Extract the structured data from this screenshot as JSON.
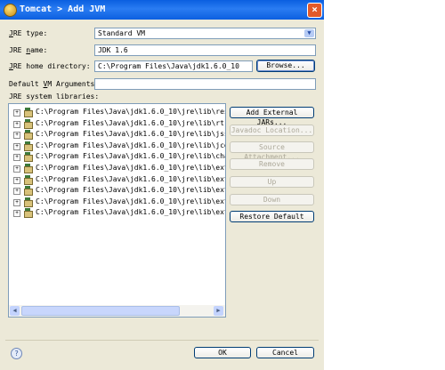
{
  "window": {
    "title": "Tomcat > Add JVM",
    "close_label": "×"
  },
  "form": {
    "jre_type": {
      "label_prefix": "",
      "label_mnemonic": "J",
      "label_rest": "RE type:",
      "value": "Standard VM"
    },
    "jre_name": {
      "label_prefix": "JRE ",
      "label_mnemonic": "n",
      "label_rest": "ame:",
      "value": "JDK 1.6"
    },
    "jre_home": {
      "label_prefix": "",
      "label_mnemonic": "J",
      "label_rest": "RE home directory:",
      "value": "C:\\Program Files\\Java\\jdk1.6.0_10",
      "browse": "Browse..."
    },
    "vm_args": {
      "label_prefix": "Default ",
      "label_mnemonic": "V",
      "label_rest": "M Arguments:",
      "value": ""
    },
    "libraries_label": "JRE system libraries:"
  },
  "libraries": [
    "C:\\Program Files\\Java\\jdk1.6.0_10\\jre\\lib\\resour",
    "C:\\Program Files\\Java\\jdk1.6.0_10\\jre\\lib\\rt.jar",
    "C:\\Program Files\\Java\\jdk1.6.0_10\\jre\\lib\\jsse.j",
    "C:\\Program Files\\Java\\jdk1.6.0_10\\jre\\lib\\jce.ja",
    "C:\\Program Files\\Java\\jdk1.6.0_10\\jre\\lib\\charse",
    "C:\\Program Files\\Java\\jdk1.6.0_10\\jre\\lib\\ext\\dn",
    "C:\\Program Files\\Java\\jdk1.6.0_10\\jre\\lib\\ext\\lo",
    "C:\\Program Files\\Java\\jdk1.6.0_10\\jre\\lib\\ext\\su",
    "C:\\Program Files\\Java\\jdk1.6.0_10\\jre\\lib\\ext\\su",
    "C:\\Program Files\\Java\\jdk1.6.0_10\\jre\\lib\\ext\\su"
  ],
  "side_buttons": {
    "add_external_jars": "Add External JARs...",
    "javadoc_location": "Javadoc Location...",
    "source_attachment": "Source Attachment...",
    "remove": "Remove",
    "up": "Up",
    "down": "Down",
    "restore_default": "Restore Default"
  },
  "footer": {
    "help": "?",
    "ok": "OK",
    "cancel": "Cancel"
  },
  "colors": {
    "titlebar": "#0a5fe0",
    "dialog_bg": "#ece9d8",
    "field_border": "#7f9db9"
  }
}
